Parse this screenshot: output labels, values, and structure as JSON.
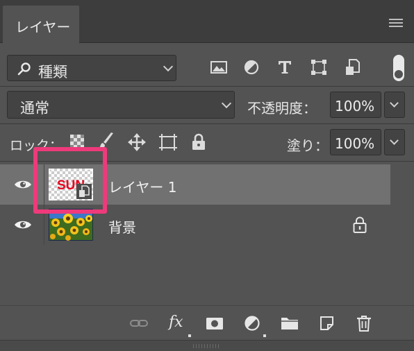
{
  "panel": {
    "tab_label": "レイヤー"
  },
  "filter": {
    "label": "種類",
    "icons": [
      "image-filter-icon",
      "adjustment-filter-icon",
      "type-filter-icon",
      "shape-filter-icon",
      "smart-object-filter-icon"
    ]
  },
  "blend": {
    "mode": "通常",
    "opacity_label": "不透明度：",
    "opacity_value": "100%"
  },
  "lock": {
    "label": "ロック：",
    "fill_label": "塗り：",
    "fill_value": "100%"
  },
  "layers": [
    {
      "name": "レイヤー 1",
      "thumb_text": "SUN",
      "selected": true
    },
    {
      "name": "背景",
      "locked": true,
      "selected": false
    }
  ],
  "colors": {
    "panel_bg": "#535353",
    "tab_bar": "#3d3d3d",
    "selected_row": "#717171",
    "highlight": "#ee3a7b",
    "thumb_text": "#e8001c"
  },
  "bottom_bar": {
    "fx_label": "fx"
  }
}
